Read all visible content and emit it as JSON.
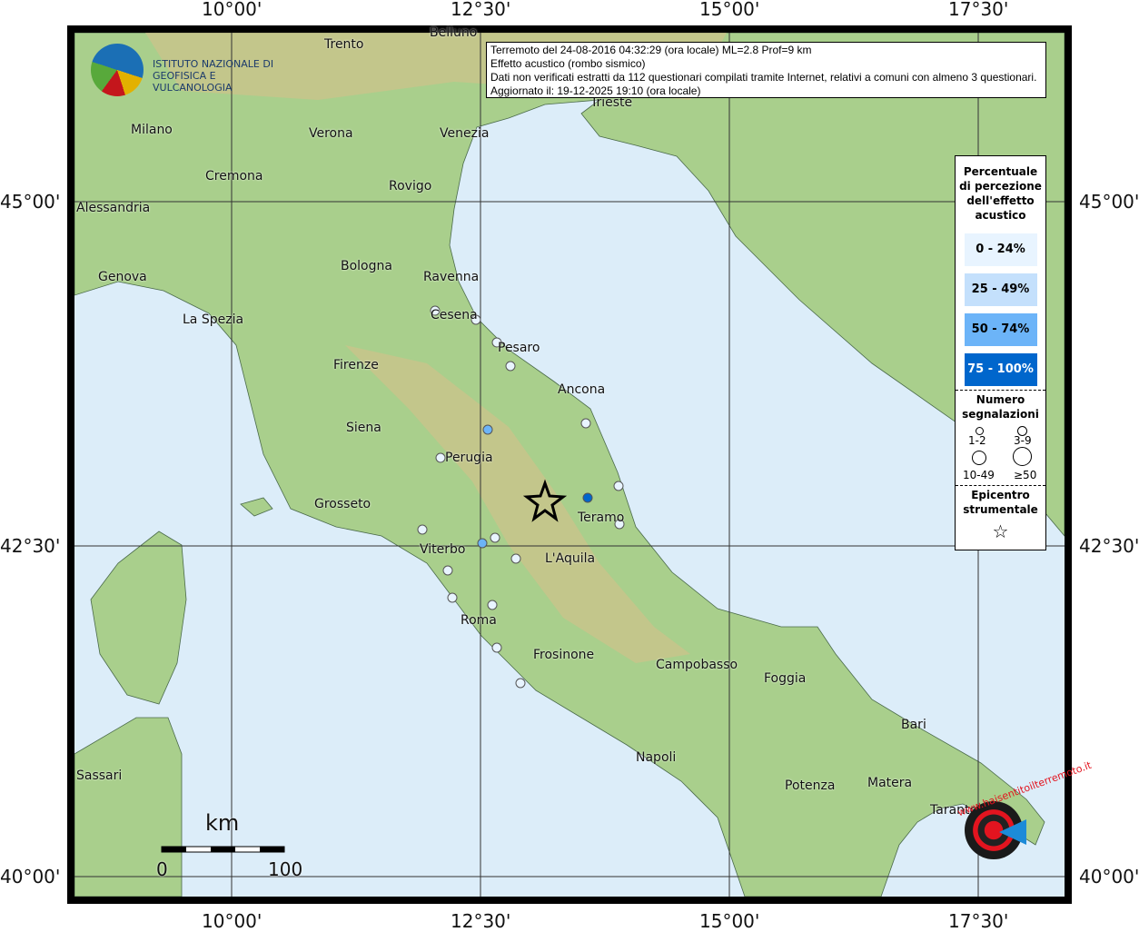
{
  "axes": {
    "lon": [
      "10°00'",
      "12°30'",
      "15°00'",
      "17°30'"
    ],
    "lat": [
      "45°00'",
      "42°30'",
      "40°00'"
    ]
  },
  "info": {
    "line1": "Terremoto del 24-08-2016 04:32:29 (ora locale) ML=2.8 Prof=9 km",
    "line2": "Effetto acustico (rombo sismico)",
    "line3": "Dati non verificati estratti da 112 questionari compilati tramite Internet, relativi a comuni con almeno 3 questionari.",
    "line4": "Aggiornato il: 19-12-2025 19:10 (ora locale)"
  },
  "logo_ingv": "ISTITUTO NAZIONALE DI GEOFISICA E VULCANOLOGIA",
  "logo_hst": "www.haisentitoilterremoto.it",
  "legend": {
    "title": "Percentuale di percezione dell'effetto acustico",
    "classes": [
      {
        "label": "0 - 24%",
        "color": "#e8f4ff"
      },
      {
        "label": "25 - 49%",
        "color": "#c4e0fc"
      },
      {
        "label": "50 - 74%",
        "color": "#6cb4f8"
      },
      {
        "label": "75 - 100%",
        "color": "#0066cc"
      }
    ],
    "count_title": "Numero segnalazioni",
    "counts": [
      "1-2",
      "3-9",
      "10-49",
      "≥50"
    ],
    "epi_title": "Epicentro strumentale"
  },
  "scale": {
    "unit": "km",
    "min": "0",
    "max": "100"
  },
  "cities": [
    "Trento",
    "Belluno",
    "Milano",
    "Verona",
    "Venezia",
    "Trieste",
    "Cremona",
    "Rovigo",
    "Alessandria",
    "Genova",
    "Bologna",
    "Ravenna",
    "La Spezia",
    "Cesena",
    "Pesaro",
    "Firenze",
    "Ancona",
    "Siena",
    "Perugia",
    "Grosseto",
    "Teramo",
    "Viterbo",
    "L'Aquila",
    "Roma",
    "Frosinone",
    "Campobasso",
    "Foggia",
    "Bari",
    "Napoli",
    "Potenza",
    "Matera",
    "Taranto",
    "Sassari"
  ],
  "points": [
    0,
    0,
    0,
    0,
    0,
    0,
    0,
    0,
    0,
    0,
    0,
    0,
    0,
    0,
    0,
    0,
    2,
    2,
    3
  ]
}
